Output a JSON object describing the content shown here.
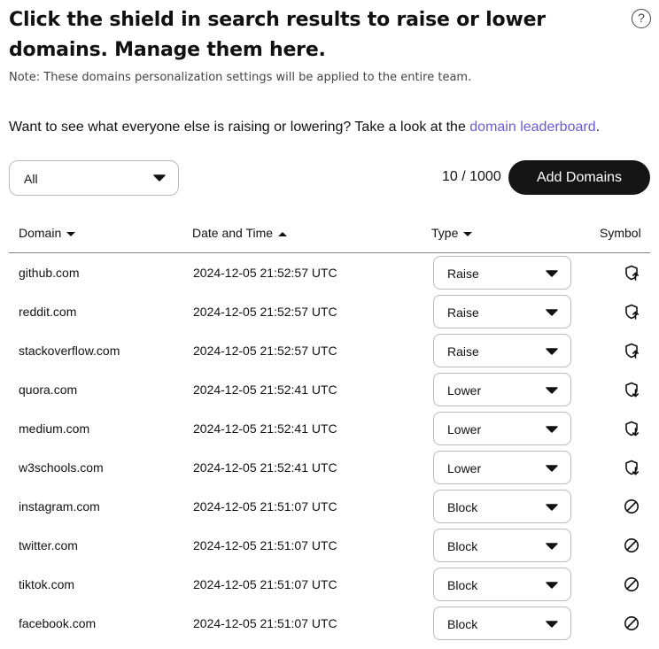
{
  "header": {
    "title": "Click the shield in search results to raise or lower domains. Manage them here.",
    "note": "Note: These domains personalization settings will be applied to the entire team.",
    "leaderboard_prefix": "Want to see what everyone else is raising or lowering? Take a look at the ",
    "leaderboard_link": "domain leaderboard",
    "leaderboard_suffix": ".",
    "help_symbol": "?"
  },
  "toolbar": {
    "filter_value": "All",
    "count": "10 / 1000",
    "add_label": "Add Domains"
  },
  "table": {
    "columns": {
      "domain": "Domain",
      "date": "Date and Time",
      "type": "Type",
      "symbol": "Symbol"
    },
    "rows": [
      {
        "domain": "github.com",
        "date": "2024-12-05 21:52:57 UTC",
        "type": "Raise",
        "symbol": "shield-up-icon"
      },
      {
        "domain": "reddit.com",
        "date": "2024-12-05 21:52:57 UTC",
        "type": "Raise",
        "symbol": "shield-up-icon"
      },
      {
        "domain": "stackoverflow.com",
        "date": "2024-12-05 21:52:57 UTC",
        "type": "Raise",
        "symbol": "shield-up-icon"
      },
      {
        "domain": "quora.com",
        "date": "2024-12-05 21:52:41 UTC",
        "type": "Lower",
        "symbol": "shield-down-icon"
      },
      {
        "domain": "medium.com",
        "date": "2024-12-05 21:52:41 UTC",
        "type": "Lower",
        "symbol": "shield-down-icon"
      },
      {
        "domain": "w3schools.com",
        "date": "2024-12-05 21:52:41 UTC",
        "type": "Lower",
        "symbol": "shield-down-icon"
      },
      {
        "domain": "instagram.com",
        "date": "2024-12-05 21:51:07 UTC",
        "type": "Block",
        "symbol": "block-icon"
      },
      {
        "domain": "twitter.com",
        "date": "2024-12-05 21:51:07 UTC",
        "type": "Block",
        "symbol": "block-icon"
      },
      {
        "domain": "tiktok.com",
        "date": "2024-12-05 21:51:07 UTC",
        "type": "Block",
        "symbol": "block-icon"
      },
      {
        "domain": "facebook.com",
        "date": "2024-12-05 21:51:07 UTC",
        "type": "Block",
        "symbol": "block-icon"
      }
    ]
  },
  "colors": {
    "link": "#6b5bd3",
    "button_bg": "#151515"
  }
}
